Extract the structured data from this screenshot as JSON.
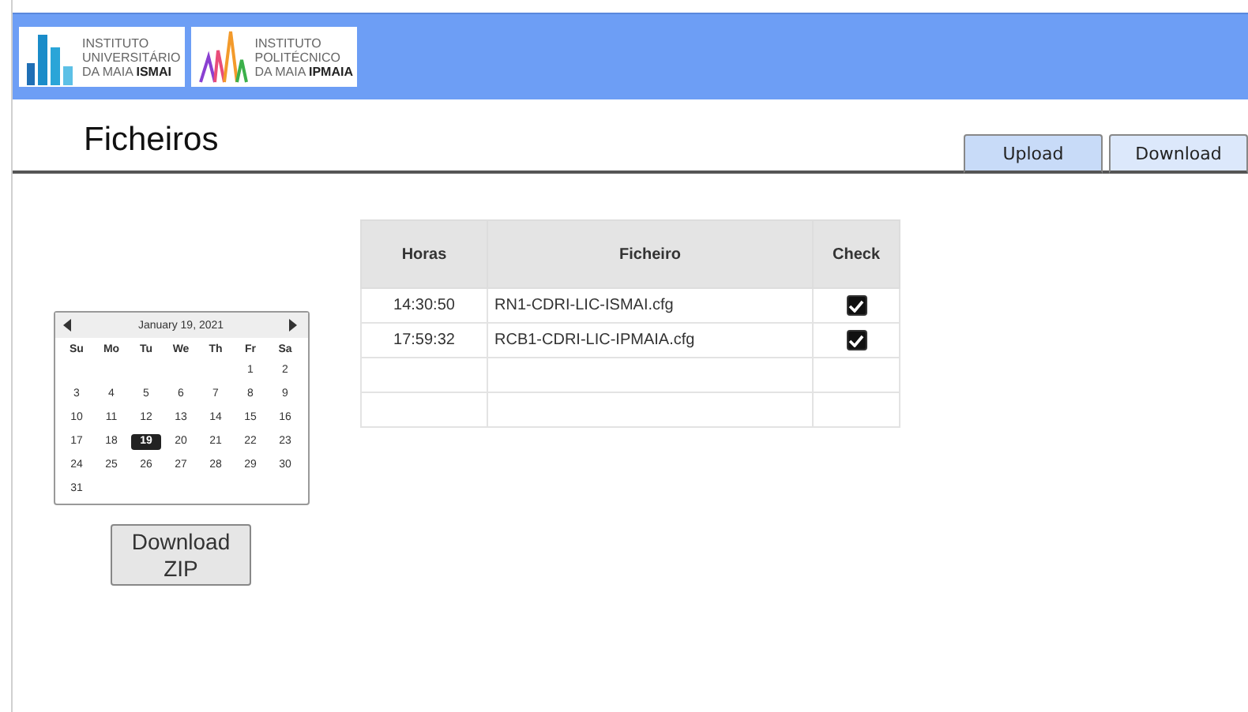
{
  "header": {
    "logos": [
      {
        "kind": "ismai",
        "lines": [
          "INSTITUTO",
          "UNIVERSITÁRIO"
        ],
        "last_plain": "DA MAIA",
        "last_bold": "ISMAI"
      },
      {
        "kind": "ipmaia",
        "lines": [
          "INSTITUTO",
          "POLITÉCNICO"
        ],
        "last_plain": "DA MAIA",
        "last_bold": "IPMAIA"
      }
    ]
  },
  "page_title": "Ficheiros",
  "tabs": [
    {
      "label": "Upload",
      "selected": true
    },
    {
      "label": "Download",
      "selected": false
    }
  ],
  "calendar": {
    "title": "January 19, 2021",
    "weekdays": [
      "Su",
      "Mo",
      "Tu",
      "We",
      "Th",
      "Fr",
      "Sa"
    ],
    "weeks": [
      [
        {
          "day": "1",
          "selected": false
        },
        {
          "day": "2",
          "selected": false
        }
      ],
      [
        {
          "day": "3",
          "selected": false
        },
        {
          "day": "4",
          "selected": false
        },
        {
          "day": "5",
          "selected": false
        },
        {
          "day": "6",
          "selected": false
        },
        {
          "day": "7",
          "selected": false
        },
        {
          "day": "8",
          "selected": false
        },
        {
          "day": "9",
          "selected": false
        }
      ],
      [
        {
          "day": "10",
          "selected": false
        },
        {
          "day": "11",
          "selected": false
        },
        {
          "day": "12",
          "selected": false
        },
        {
          "day": "13",
          "selected": false
        },
        {
          "day": "14",
          "selected": false
        },
        {
          "day": "15",
          "selected": false
        },
        {
          "day": "16",
          "selected": false
        }
      ],
      [
        {
          "day": "17",
          "selected": false
        },
        {
          "day": "18",
          "selected": false
        },
        {
          "day": "19",
          "selected": true
        },
        {
          "day": "20",
          "selected": false
        },
        {
          "day": "21",
          "selected": false
        },
        {
          "day": "22",
          "selected": false
        },
        {
          "day": "23",
          "selected": false
        }
      ],
      [
        {
          "day": "24",
          "selected": false
        },
        {
          "day": "25",
          "selected": false
        },
        {
          "day": "26",
          "selected": false
        },
        {
          "day": "27",
          "selected": false
        },
        {
          "day": "28",
          "selected": false
        },
        {
          "day": "29",
          "selected": false
        },
        {
          "day": "30",
          "selected": false
        }
      ],
      [
        {
          "day": "31",
          "selected": false
        }
      ]
    ]
  },
  "zip_button": {
    "lines": [
      "Download",
      "ZIP"
    ]
  },
  "table": {
    "columns": [
      "Horas",
      "Ficheiro",
      "Check"
    ],
    "rows": [
      {
        "time": "14:30:50",
        "file": "RN1-CDRI-LIC-ISMAI.cfg",
        "checked": true
      },
      {
        "time": "17:59:32",
        "file": "RCB1-CDRI-LIC-IPMAIA.cfg",
        "checked": true
      }
    ]
  }
}
